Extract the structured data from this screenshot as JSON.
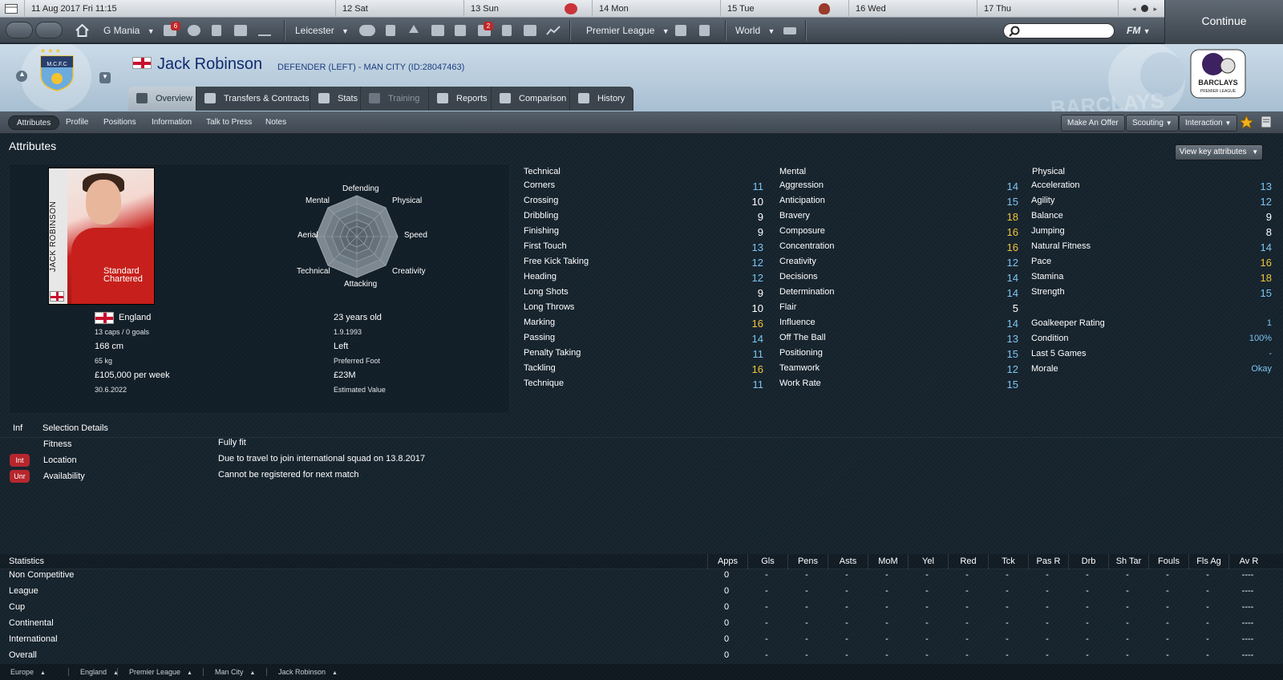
{
  "datebar": {
    "today": "11 Aug 2017  Fri  11:15",
    "days": [
      "12  Sat",
      "13  Sun",
      "14  Mon",
      "15  Tue",
      "16  Wed",
      "17  Thu"
    ]
  },
  "toolbar": {
    "manager": "G Mania",
    "inbox_badge": "6",
    "club": "Leicester",
    "club_badge": "2",
    "competition": "Premier League",
    "world": "World",
    "search_placeholder": "",
    "fm_label": "FM",
    "continue_label": "Continue"
  },
  "header": {
    "player_name": "Jack Robinson",
    "subtitle": "DEFENDER (LEFT) - MAN CITY (ID:28047463)",
    "watermark_left": "",
    "watermark_right": "BARCLAYS",
    "crest_text": "M.C.F.C",
    "pl_logo_text": "BARCLAYS",
    "pl_logo_sub": "PREMIER LEAGUE"
  },
  "tabs": [
    {
      "label": "Overview",
      "icon": "overview-icon"
    },
    {
      "label": "Transfers & Contracts",
      "icon": "contract-icon"
    },
    {
      "label": "Stats",
      "icon": "stats-icon"
    },
    {
      "label": "Training",
      "icon": "training-icon"
    },
    {
      "label": "Reports",
      "icon": "report-icon"
    },
    {
      "label": "Comparison",
      "icon": "comparison-icon"
    },
    {
      "label": "History",
      "icon": "history-icon"
    }
  ],
  "subnav": {
    "items": [
      "Attributes",
      "Profile",
      "Positions",
      "Information",
      "Talk to Press",
      "Notes"
    ],
    "actions": [
      "Make An Offer",
      "Scouting",
      "Interaction"
    ]
  },
  "attributes_title": "Attributes",
  "view_key_label": "View key attributes",
  "profile": {
    "photo_name": "JACK ROBINSON",
    "sponsor": "Standard Chartered",
    "nation": "England",
    "caps": "13 caps / 0 goals",
    "height": "168 cm",
    "weight": "65 kg",
    "wage": "£105,000 per week",
    "contract_end": "30.6.2022",
    "age": "23 years old",
    "dob": "1.9.1993",
    "foot": "Left",
    "foot_label": "Preferred Foot",
    "value": "£23M",
    "value_label": "Estimated Value"
  },
  "radar": {
    "labels": [
      "Defending",
      "Physical",
      "Speed",
      "Creativity",
      "Attacking",
      "Technical",
      "Aerial",
      "Mental"
    ]
  },
  "technical": {
    "title": "Technical",
    "rows": [
      {
        "name": "Corners",
        "value": "11",
        "tone": "blue"
      },
      {
        "name": "Crossing",
        "value": "10",
        "tone": "white"
      },
      {
        "name": "Dribbling",
        "value": "9",
        "tone": "white"
      },
      {
        "name": "Finishing",
        "value": "9",
        "tone": "white"
      },
      {
        "name": "First Touch",
        "value": "13",
        "tone": "blue"
      },
      {
        "name": "Free Kick Taking",
        "value": "12",
        "tone": "blue"
      },
      {
        "name": "Heading",
        "value": "12",
        "tone": "blue"
      },
      {
        "name": "Long Shots",
        "value": "9",
        "tone": "white"
      },
      {
        "name": "Long Throws",
        "value": "10",
        "tone": "white"
      },
      {
        "name": "Marking",
        "value": "16",
        "tone": "yellow"
      },
      {
        "name": "Passing",
        "value": "14",
        "tone": "blue"
      },
      {
        "name": "Penalty Taking",
        "value": "11",
        "tone": "blue"
      },
      {
        "name": "Tackling",
        "value": "16",
        "tone": "yellow"
      },
      {
        "name": "Technique",
        "value": "11",
        "tone": "blue"
      }
    ]
  },
  "mental": {
    "title": "Mental",
    "rows": [
      {
        "name": "Aggression",
        "value": "14",
        "tone": "blue"
      },
      {
        "name": "Anticipation",
        "value": "15",
        "tone": "blue"
      },
      {
        "name": "Bravery",
        "value": "18",
        "tone": "yellow"
      },
      {
        "name": "Composure",
        "value": "16",
        "tone": "yellow"
      },
      {
        "name": "Concentration",
        "value": "16",
        "tone": "yellow"
      },
      {
        "name": "Creativity",
        "value": "12",
        "tone": "blue"
      },
      {
        "name": "Decisions",
        "value": "14",
        "tone": "blue"
      },
      {
        "name": "Determination",
        "value": "14",
        "tone": "blue"
      },
      {
        "name": "Flair",
        "value": "5",
        "tone": "white"
      },
      {
        "name": "Influence",
        "value": "14",
        "tone": "blue"
      },
      {
        "name": "Off The Ball",
        "value": "13",
        "tone": "blue"
      },
      {
        "name": "Positioning",
        "value": "15",
        "tone": "blue"
      },
      {
        "name": "Teamwork",
        "value": "12",
        "tone": "blue"
      },
      {
        "name": "Work Rate",
        "value": "15",
        "tone": "blue"
      }
    ]
  },
  "physical": {
    "title": "Physical",
    "rows": [
      {
        "name": "Acceleration",
        "value": "13",
        "tone": "blue"
      },
      {
        "name": "Agility",
        "value": "12",
        "tone": "blue"
      },
      {
        "name": "Balance",
        "value": "9",
        "tone": "white"
      },
      {
        "name": "Jumping",
        "value": "8",
        "tone": "white"
      },
      {
        "name": "Natural Fitness",
        "value": "14",
        "tone": "blue"
      },
      {
        "name": "Pace",
        "value": "16",
        "tone": "yellow"
      },
      {
        "name": "Stamina",
        "value": "18",
        "tone": "yellow"
      },
      {
        "name": "Strength",
        "value": "15",
        "tone": "blue"
      }
    ],
    "extra": [
      {
        "name": "Goalkeeper Rating",
        "value": "1"
      },
      {
        "name": "Condition",
        "value": "100%"
      },
      {
        "name": "Last 5 Games",
        "value": "-"
      },
      {
        "name": "Morale",
        "value": "Okay"
      }
    ]
  },
  "selection": {
    "inf_header": "Inf",
    "title": "Selection Details",
    "rows": [
      {
        "badge": "",
        "label": "Fitness",
        "value": "Fully fit"
      },
      {
        "badge": "Int",
        "label": "Location",
        "value": "Due to travel to join international squad on 13.8.2017"
      },
      {
        "badge": "Unr",
        "label": "Availability",
        "value": "Cannot be registered for next match"
      }
    ]
  },
  "statistics": {
    "title": "Statistics",
    "columns": [
      "Apps",
      "Gls",
      "Pens",
      "Asts",
      "MoM",
      "Yel",
      "Red",
      "Tck",
      "Pas R",
      "Drb",
      "Sh Tar",
      "Fouls",
      "Fls Ag",
      "Av R"
    ],
    "rows": [
      {
        "name": "Non Competitive",
        "cells": [
          "0",
          "-",
          "-",
          "-",
          "-",
          "-",
          "-",
          "-",
          "-",
          "-",
          "-",
          "-",
          "-",
          "----"
        ]
      },
      {
        "name": "League",
        "cells": [
          "0",
          "-",
          "-",
          "-",
          "-",
          "-",
          "-",
          "-",
          "-",
          "-",
          "-",
          "-",
          "-",
          "----"
        ]
      },
      {
        "name": "Cup",
        "cells": [
          "0",
          "-",
          "-",
          "-",
          "-",
          "-",
          "-",
          "-",
          "-",
          "-",
          "-",
          "-",
          "-",
          "----"
        ]
      },
      {
        "name": "Continental",
        "cells": [
          "0",
          "-",
          "-",
          "-",
          "-",
          "-",
          "-",
          "-",
          "-",
          "-",
          "-",
          "-",
          "-",
          "----"
        ]
      },
      {
        "name": "International",
        "cells": [
          "0",
          "-",
          "-",
          "-",
          "-",
          "-",
          "-",
          "-",
          "-",
          "-",
          "-",
          "-",
          "-",
          "----"
        ]
      },
      {
        "name": "Overall",
        "cells": [
          "0",
          "-",
          "-",
          "-",
          "-",
          "-",
          "-",
          "-",
          "-",
          "-",
          "-",
          "-",
          "-",
          "----"
        ]
      }
    ]
  },
  "breadcrumb": [
    "Europe",
    "England",
    "Premier League",
    "Man City",
    "Jack Robinson"
  ],
  "colors": {
    "blue_value": "#7ec4f0",
    "yellow_value": "#f0c43a",
    "badge_red": "#b6262d",
    "name_blue": "#0e2a6e"
  }
}
